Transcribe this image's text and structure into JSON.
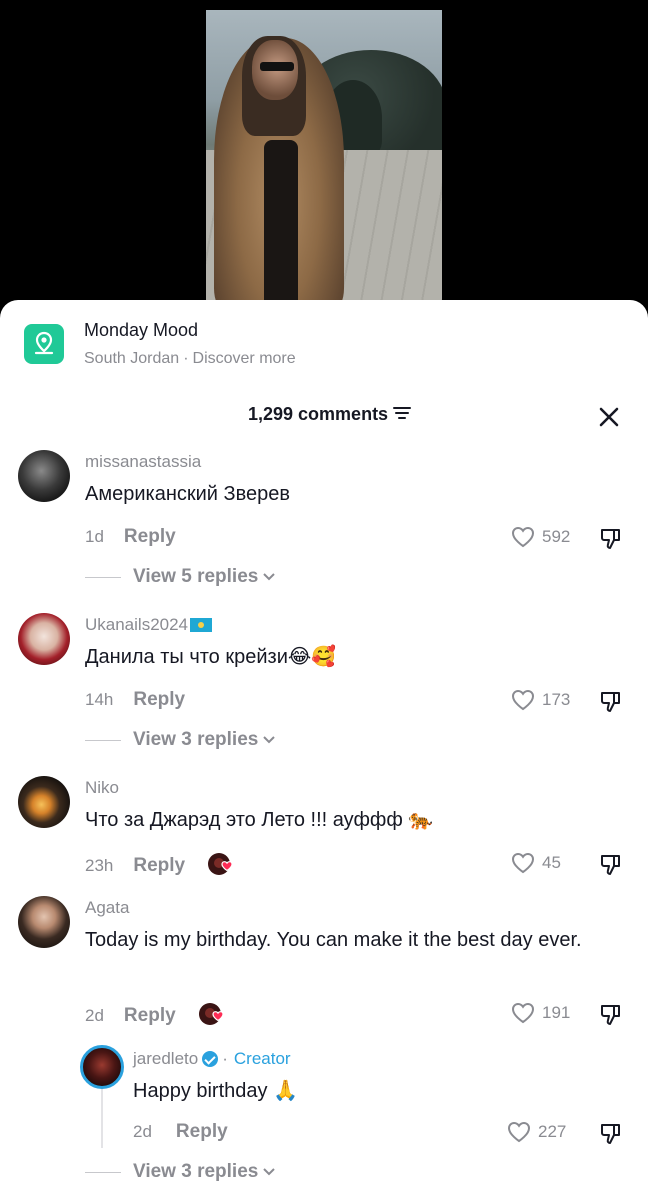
{
  "promo": {
    "title": "Monday Mood",
    "location": "South Jordan",
    "separator": "·",
    "discover": "Discover more",
    "icon": "location-pin-icon",
    "icon_color": "#20c997"
  },
  "header": {
    "comments_count": "1,299 comments",
    "filter_icon": "filter-icon",
    "close_icon": "close-icon"
  },
  "comments": [
    {
      "username": "missanastassia",
      "text": "Американский Зверев",
      "time": "1d",
      "reply_label": "Reply",
      "likes": "592",
      "view_replies": "View 5 replies"
    },
    {
      "username": "Ukanails2024",
      "text": "Данила ты что крейзи😂🥰",
      "time": "14h",
      "reply_label": "Reply",
      "likes": "173",
      "view_replies": "View 3 replies"
    },
    {
      "username": "Niko",
      "text": "Что за Джарэд это Лето !!! ауффф 🐅",
      "time": "23h",
      "reply_label": "Reply",
      "likes": "45"
    },
    {
      "username": "Agata",
      "text": "Today is my birthday. You can make it the best day ever.",
      "time": "2d",
      "reply_label": "Reply",
      "likes": "191",
      "view_replies": "View 3 replies"
    }
  ],
  "creator_reply": {
    "username": "jaredleto",
    "separator": "·",
    "creator_label": "Creator",
    "text": "Happy birthday 🙏",
    "time": "2d",
    "reply_label": "Reply",
    "likes": "227"
  },
  "colors": {
    "muted_text": "#8a8b91",
    "primary_text": "#161823",
    "creator_blue": "#2aa1de",
    "liked_heart": "#fe2c55"
  }
}
